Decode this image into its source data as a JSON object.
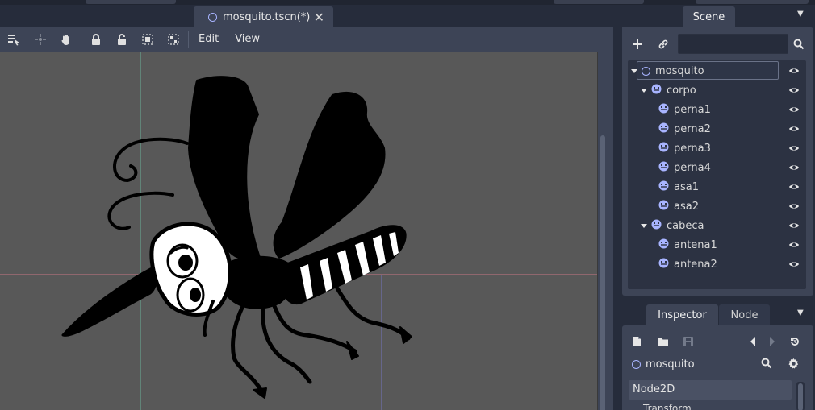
{
  "editor": {
    "tab": {
      "title": "mosquito.tscn(*)",
      "close_symbol": "✕"
    },
    "menus": [
      "Edit",
      "View"
    ],
    "toolbar_icons": [
      "select-mode-icon",
      "move-pivot-icon",
      "pan-icon",
      "lock-icon",
      "unlock-icon",
      "group-icon",
      "ungroup-icon"
    ]
  },
  "scene_dock": {
    "tab_label": "Scene",
    "filter_placeholder": "",
    "tree": [
      {
        "name": "mosquito",
        "type": "node2d",
        "depth": 0,
        "expanded": true,
        "selected": true
      },
      {
        "name": "corpo",
        "type": "sprite",
        "depth": 1,
        "expanded": true
      },
      {
        "name": "perna1",
        "type": "sprite",
        "depth": 2
      },
      {
        "name": "perna2",
        "type": "sprite",
        "depth": 2
      },
      {
        "name": "perna3",
        "type": "sprite",
        "depth": 2
      },
      {
        "name": "perna4",
        "type": "sprite",
        "depth": 2
      },
      {
        "name": "asa1",
        "type": "sprite",
        "depth": 2
      },
      {
        "name": "asa2",
        "type": "sprite",
        "depth": 2
      },
      {
        "name": "cabeca",
        "type": "sprite",
        "depth": 1,
        "expanded": true
      },
      {
        "name": "antena1",
        "type": "sprite",
        "depth": 2
      },
      {
        "name": "antena2",
        "type": "sprite",
        "depth": 2
      }
    ]
  },
  "inspector_dock": {
    "tabs": {
      "inspector": "Inspector",
      "node": "Node"
    },
    "object_name": "mosquito",
    "class_section": "Node2D",
    "property_group": "Transform"
  },
  "colors": {
    "accent": "#a8b4ff",
    "panel": "#3d4456",
    "background": "#262c3b",
    "viewport": "#585858"
  }
}
